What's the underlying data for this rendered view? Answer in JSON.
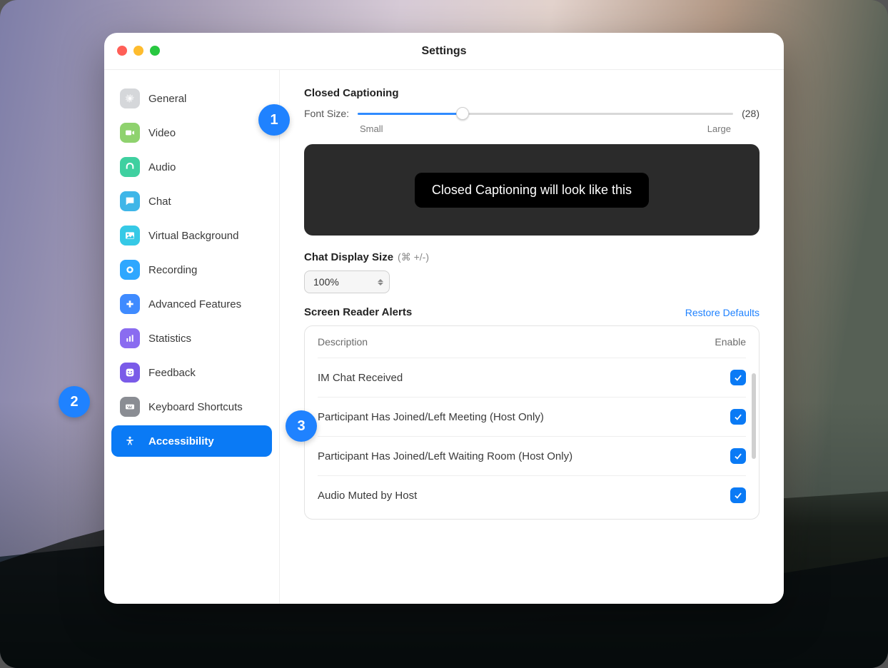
{
  "window": {
    "title": "Settings"
  },
  "sidebar": {
    "items": [
      {
        "id": "general",
        "label": "General",
        "icon": "gear-icon",
        "color": "#d5d7da",
        "active": false
      },
      {
        "id": "video",
        "label": "Video",
        "icon": "video-icon",
        "color": "#8fd26e",
        "active": false
      },
      {
        "id": "audio",
        "label": "Audio",
        "icon": "headset-icon",
        "color": "#3fd0a0",
        "active": false
      },
      {
        "id": "chat",
        "label": "Chat",
        "icon": "chat-icon",
        "color": "#3fb6e8",
        "active": false
      },
      {
        "id": "virtual-bg",
        "label": "Virtual Background",
        "icon": "image-icon",
        "color": "#36c9e6",
        "active": false
      },
      {
        "id": "recording",
        "label": "Recording",
        "icon": "record-icon",
        "color": "#2ea7ff",
        "active": false
      },
      {
        "id": "advanced",
        "label": "Advanced Features",
        "icon": "plus-icon",
        "color": "#3f8bff",
        "active": false
      },
      {
        "id": "statistics",
        "label": "Statistics",
        "icon": "bars-icon",
        "color": "#8a6cf0",
        "active": false
      },
      {
        "id": "feedback",
        "label": "Feedback",
        "icon": "smile-icon",
        "color": "#7a5be8",
        "active": false
      },
      {
        "id": "keyboard",
        "label": "Keyboard Shortcuts",
        "icon": "keyboard-icon",
        "color": "#8a8d93",
        "active": false
      },
      {
        "id": "accessibility",
        "label": "Accessibility",
        "icon": "accessibility-icon",
        "color": "#0a7af5",
        "active": true
      }
    ]
  },
  "captioning": {
    "title": "Closed Captioning",
    "font_label": "Font Size:",
    "min_label": "Small",
    "max_label": "Large",
    "value_display": "(28)",
    "slider_percent": 28,
    "preview_text": "Closed Captioning will look like this"
  },
  "chat_display": {
    "title": "Chat Display Size",
    "hint": "(⌘ +/-)",
    "value": "100%"
  },
  "alerts": {
    "title": "Screen Reader Alerts",
    "restore": "Restore Defaults",
    "columns": {
      "desc": "Description",
      "enable": "Enable"
    },
    "rows": [
      {
        "desc": "IM Chat Received",
        "enabled": true
      },
      {
        "desc": "Participant Has Joined/Left Meeting (Host Only)",
        "enabled": true
      },
      {
        "desc": "Participant Has Joined/Left Waiting Room (Host Only)",
        "enabled": true
      },
      {
        "desc": "Audio Muted by Host",
        "enabled": true
      }
    ]
  },
  "callouts": {
    "one": "1",
    "two": "2",
    "three": "3"
  }
}
